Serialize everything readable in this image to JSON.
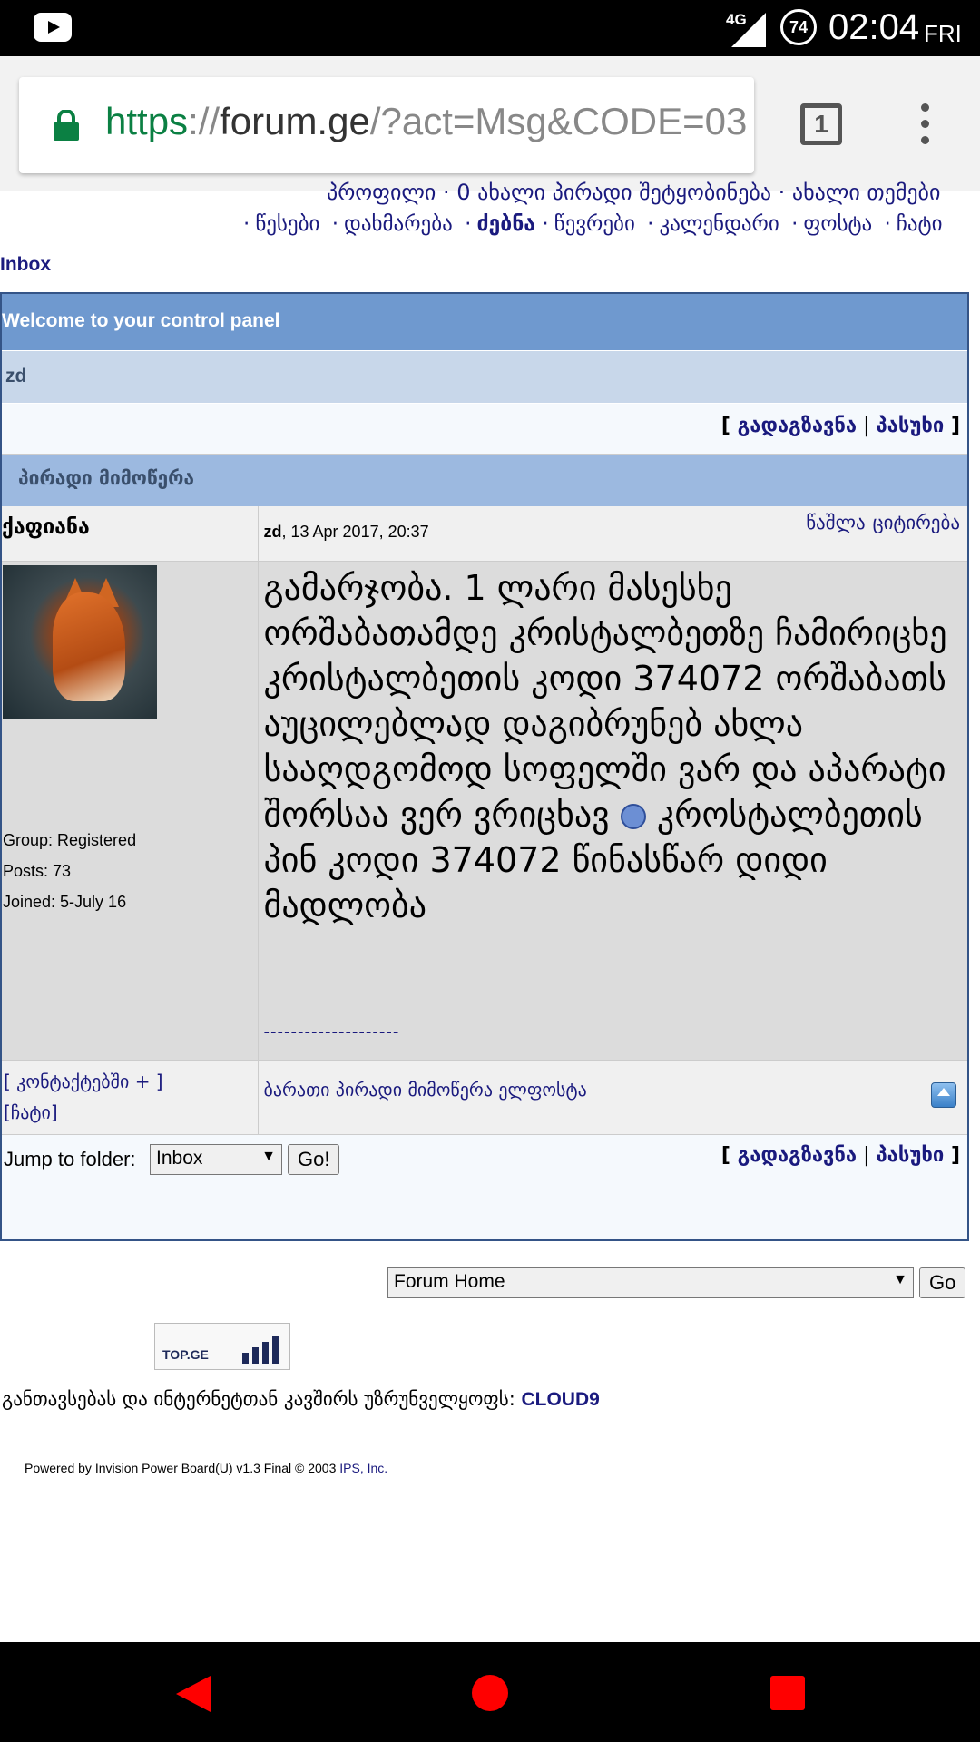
{
  "status_bar": {
    "network": "4G",
    "battery": "74",
    "time": "02:04",
    "day": "FRI"
  },
  "browser": {
    "url_scheme": "https",
    "url_sep": "://",
    "url_host": "forum.ge",
    "url_path": "/?act=Msg&CODE=03",
    "tab_count": "1"
  },
  "nav": {
    "clipped_line": "პროფილი · 0 ახალი პირადი შეტყობინება · ახალი თემები",
    "items": [
      "წესები",
      "დახმარება",
      "ძებნა",
      "წევრები",
      "კალენდარი",
      "ფოსტა",
      "ჩატი"
    ],
    "breadcrumb": "Inbox"
  },
  "panel": {
    "title": "Welcome to your control panel",
    "subject": "zd",
    "forward_label": "გადაგზავნა",
    "reply_label": "პასუხი",
    "section_title": "პირადი მიმოწერა"
  },
  "message": {
    "author": "ქაფიანა",
    "sender": "zd",
    "date": ", 13 Apr 2017, 20:37",
    "delete_label": "წაშლა",
    "quote_label": "ციტირება",
    "body_before": "გამარჯობა. 1 ლარი მასესხე ორშაბათამდე კრისტალბეთზე ჩამირიცხე კრისტალბეთის კოდი 374072 ორშაბათს აუცილებლად დაგიბრუნებ ახლა სააღდგომოდ სოფელში ვარ და აპარატი შორსაა ვერ ვრიცხავ",
    "body_after": " კროსტალბეთის პინ კოდი 374072 წინასწარ დიდი მადლობა",
    "signature": "--------------------",
    "group": "Group: Registered",
    "posts": "Posts: 73",
    "joined": "Joined: 5-July 16",
    "add_contact": "[ კონტაქტებში + ]",
    "chat_link": "[ჩატი]",
    "footer_links": "ბარათი პირადი მიმოწერა ელფოსტა"
  },
  "jump": {
    "label": "Jump to folder:",
    "folder": "Inbox",
    "go": "Go!"
  },
  "forum_jump": {
    "selected": "Forum Home",
    "go": "Go"
  },
  "footer": {
    "counter": "TOP.GE",
    "hosting_text": "განთავსებას და ინტერნეტთან კავშირს უზრუნველყოფს: ",
    "hosting_brand": "CLOUD9",
    "powered": "Powered by Invision Power Board(U) v1.3 Final © 2003 ",
    "powered_link": "IPS, Inc."
  }
}
